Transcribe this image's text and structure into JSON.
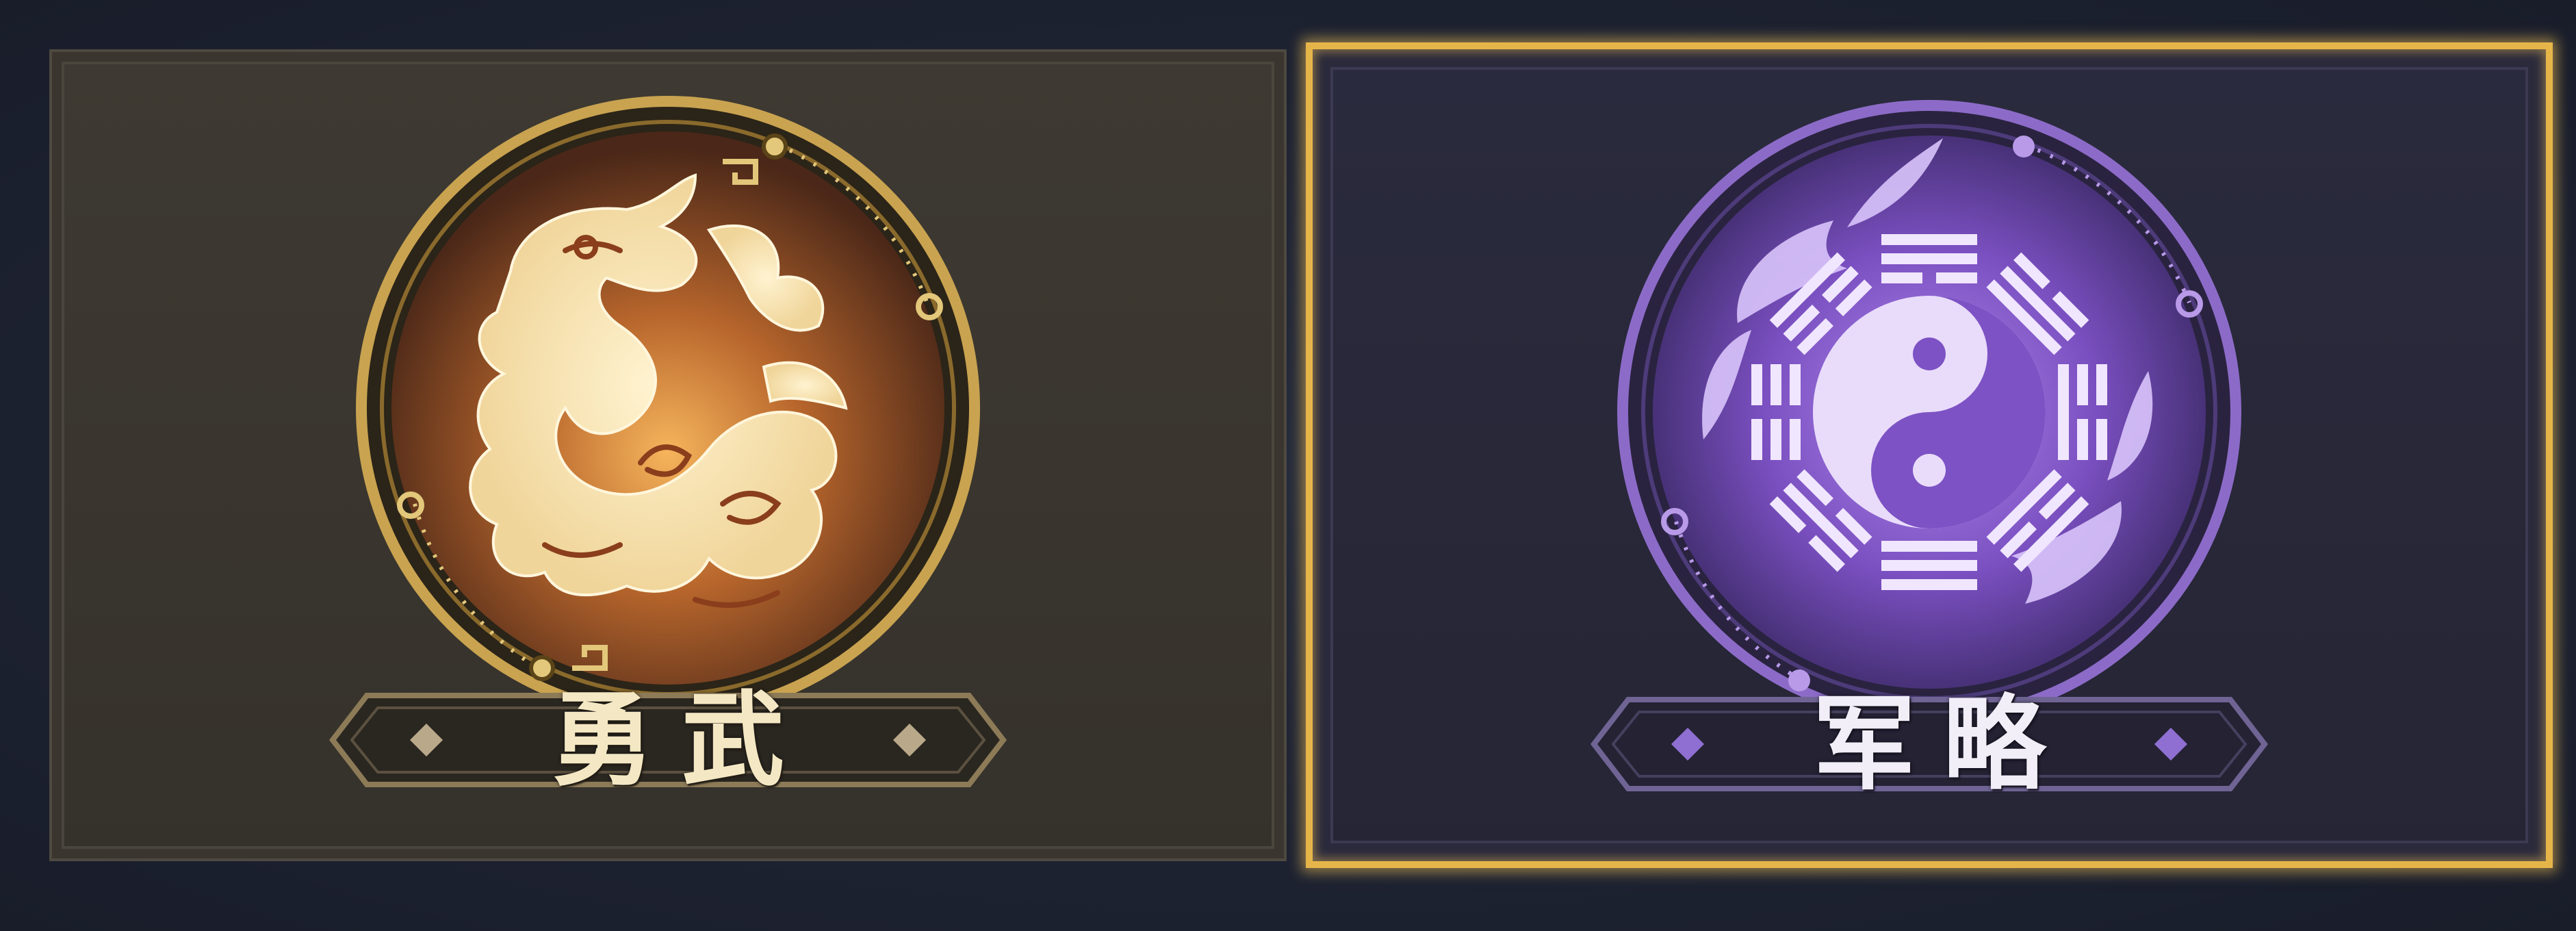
{
  "cards": [
    {
      "label": "勇武",
      "emblem": "dragon-icon",
      "selected": false,
      "accent": "#c9a350"
    },
    {
      "label": "军略",
      "emblem": "taiji-bagua-icon",
      "selected": true,
      "accent": "#9b6ad8",
      "highlight": "#f2c14e"
    }
  ]
}
